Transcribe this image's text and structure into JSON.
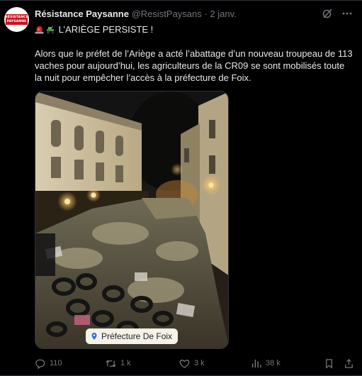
{
  "author": {
    "name": "Résistance Paysanne",
    "handle": "@ResistPaysans",
    "separator": "·",
    "date": "2 janv.",
    "avatar_text": [
      "RÉSISTANCE",
      "PAYSANNE"
    ]
  },
  "tweet": {
    "headline": "L’ARIÈGE PERSISTE !",
    "body": "Alors que le préfet de l’Ariège a acté l’abattage d’un nouveau troupeau de 113 vaches pour aujourd’hui, les agriculteurs de la CR09 se sont mobilisés toute la nuit pour empêcher l’accès à la préfecture de Foix.",
    "emojis": [
      "rotating-light-emoji",
      "tractor-emoji"
    ]
  },
  "media": {
    "location_label": "Préfecture De Foix"
  },
  "actions": {
    "replies": "110",
    "reposts": "1 k",
    "likes": "3 k",
    "views": "38 k"
  },
  "colors": {
    "background": "#000000",
    "text": "#e7e9ea",
    "muted": "#71767b",
    "brand_red": "#c8141e"
  }
}
